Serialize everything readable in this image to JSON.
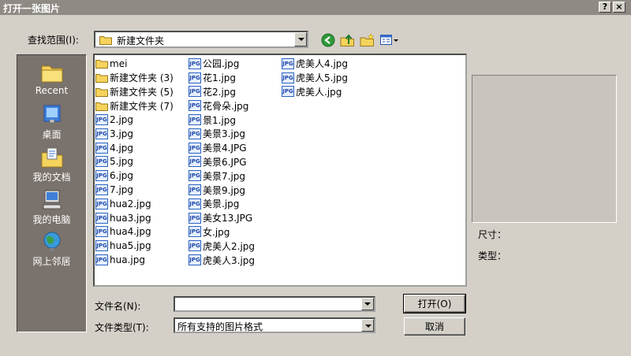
{
  "window": {
    "title": "打开一张图片",
    "help_label": "?",
    "close_label": "×"
  },
  "lookin": {
    "label": "查找范围(I):",
    "value": "新建文件夹"
  },
  "toolbar": {
    "icons": [
      "back-icon",
      "up-folder-icon",
      "new-folder-icon",
      "view-menu-icon"
    ]
  },
  "places": [
    {
      "label": "Recent",
      "icon": "recent-icon"
    },
    {
      "label": "桌面",
      "icon": "desktop-icon"
    },
    {
      "label": "我的文档",
      "icon": "my-documents-icon"
    },
    {
      "label": "我的电脑",
      "icon": "my-computer-icon"
    },
    {
      "label": "网上邻居",
      "icon": "network-icon"
    }
  ],
  "files": {
    "col1": [
      {
        "name": "mei",
        "type": "folder"
      },
      {
        "name": "新建文件夹 (3)",
        "type": "folder"
      },
      {
        "name": "新建文件夹 (5)",
        "type": "folder"
      },
      {
        "name": "新建文件夹 (7)",
        "type": "folder"
      },
      {
        "name": "2.jpg",
        "type": "jpg"
      },
      {
        "name": "3.jpg",
        "type": "jpg"
      },
      {
        "name": "4.jpg",
        "type": "jpg"
      },
      {
        "name": "5.jpg",
        "type": "jpg"
      },
      {
        "name": "6.jpg",
        "type": "jpg"
      },
      {
        "name": "7.jpg",
        "type": "jpg"
      },
      {
        "name": "hua2.jpg",
        "type": "jpg"
      },
      {
        "name": "hua3.jpg",
        "type": "jpg"
      },
      {
        "name": "hua4.jpg",
        "type": "jpg"
      },
      {
        "name": "hua5.jpg",
        "type": "jpg"
      },
      {
        "name": "hua.jpg",
        "type": "jpg"
      }
    ],
    "col2": [
      {
        "name": "公园.jpg",
        "type": "jpg"
      },
      {
        "name": "花1.jpg",
        "type": "jpg"
      },
      {
        "name": "花2.jpg",
        "type": "jpg"
      },
      {
        "name": "花骨朵.jpg",
        "type": "jpg"
      },
      {
        "name": "景1.jpg",
        "type": "jpg"
      },
      {
        "name": "美景3.jpg",
        "type": "jpg"
      },
      {
        "name": "美景4.JPG",
        "type": "jpg"
      },
      {
        "name": "美景6.JPG",
        "type": "jpg"
      },
      {
        "name": "美景7.jpg",
        "type": "jpg"
      },
      {
        "name": "美景9.jpg",
        "type": "jpg"
      },
      {
        "name": "美景.jpg",
        "type": "jpg"
      },
      {
        "name": "美女13.JPG",
        "type": "jpg"
      },
      {
        "name": "女.jpg",
        "type": "jpg"
      },
      {
        "name": "虎美人2.jpg",
        "type": "jpg"
      },
      {
        "name": "虎美人3.jpg",
        "type": "jpg"
      }
    ],
    "col3": [
      {
        "name": "虎美人4.jpg",
        "type": "jpg"
      },
      {
        "name": "虎美人5.jpg",
        "type": "jpg"
      },
      {
        "name": "虎美人.jpg",
        "type": "jpg"
      }
    ],
    "jpg_badge": "JPG"
  },
  "preview": {
    "size_label": "尺寸：",
    "type_label": "类型："
  },
  "filename": {
    "label": "文件名(N):",
    "value": ""
  },
  "filetype": {
    "label": "文件类型(T):",
    "value": "所有支持的图片格式"
  },
  "buttons": {
    "open": "打开(O)",
    "cancel": "取消"
  },
  "colors": {
    "face": "#d4d0c8",
    "titlebar": "#8f8a84",
    "places_bg": "#7a726c",
    "preview_bg": "#c9c5be",
    "jpg_blue": "#2a62c0",
    "folder_yellow": "#f5d35c"
  }
}
